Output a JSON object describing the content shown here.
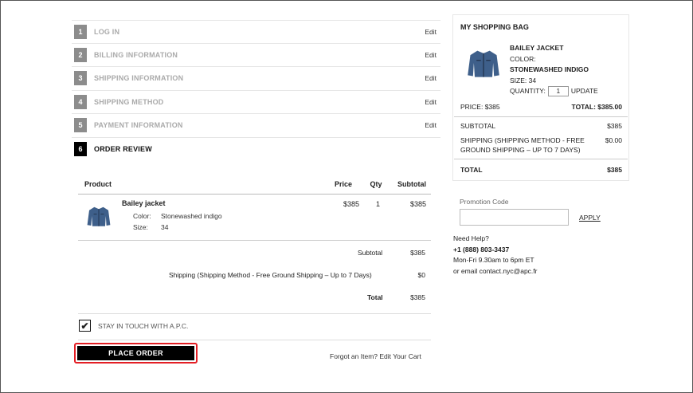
{
  "steps": [
    {
      "num": "1",
      "label": "LOG IN",
      "edit": "Edit"
    },
    {
      "num": "2",
      "label": "BILLING INFORMATION",
      "edit": "Edit"
    },
    {
      "num": "3",
      "label": "SHIPPING INFORMATION",
      "edit": "Edit"
    },
    {
      "num": "4",
      "label": "SHIPPING METHOD",
      "edit": "Edit"
    },
    {
      "num": "5",
      "label": "PAYMENT INFORMATION",
      "edit": "Edit"
    },
    {
      "num": "6",
      "label": "ORDER REVIEW"
    }
  ],
  "review": {
    "headers": {
      "product": "Product",
      "price": "Price",
      "qty": "Qty",
      "subtotal": "Subtotal"
    },
    "item": {
      "name": "Bailey jacket",
      "color_key": "Color:",
      "color_val": "Stonewashed indigo",
      "size_key": "Size:",
      "size_val": "34",
      "price": "$385",
      "qty": "1",
      "subtotal": "$385"
    },
    "subtotal_label": "Subtotal",
    "subtotal_val": "$385",
    "shipping_label": "Shipping (Shipping Method - Free Ground Shipping – Up to 7 Days)",
    "shipping_val": "$0",
    "total_label": "Total",
    "total_val": "$385"
  },
  "stay_in_touch": {
    "label": "STAY IN TOUCH WITH A.P.C.",
    "check": "✔"
  },
  "place_order": "PLACE ORDER",
  "forgot": "Forgot an Item? Edit Your Cart",
  "bag": {
    "title": "MY SHOPPING BAG",
    "item_name": "BAILEY JACKET",
    "color_label": "COLOR:",
    "color_value": "STONEWASHED INDIGO",
    "size_line": "SIZE: 34",
    "quantity_label": "QUANTITY:",
    "quantity_value": "1",
    "update": "UPDATE",
    "price_line": "PRICE: $385",
    "total_line": "TOTAL: $385.00",
    "subtotal_label": "SUBTOTAL",
    "subtotal_val": "$385",
    "shipping_label": "SHIPPING (SHIPPING METHOD - FREE GROUND SHIPPING – UP TO 7 DAYS)",
    "shipping_val": "$0.00",
    "total_label": "TOTAL",
    "total_val": "$385"
  },
  "promo": {
    "label": "Promotion Code",
    "apply": "APPLY"
  },
  "help": {
    "title": "Need Help?",
    "phone": "+1 (888) 803-3437",
    "hours": "Mon-Fri 9.30am to 6pm ET",
    "email": "or email contact.nyc@apc.fr"
  },
  "colors": {
    "accent_border": "#e31e24",
    "button_bg": "#000000",
    "step_badge": "#8c8c8c"
  },
  "icons": {
    "jacket": "denim-jacket-icon",
    "check": "checkmark-icon"
  }
}
